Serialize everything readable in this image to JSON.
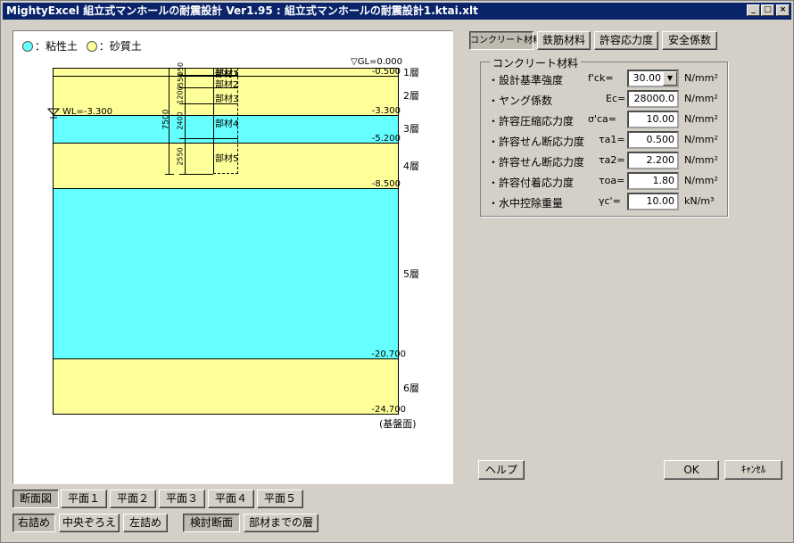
{
  "window": {
    "title": "MightyExcel 組立式マンホールの耐震設計 Ver1.95 : 組立式マンホールの耐震設計1.ktai.xlt"
  },
  "titlebar_buttons": {
    "minimize": "_",
    "maximize": "□",
    "close": "×"
  },
  "legend": {
    "clay": "：粘性土",
    "sand": "：砂質土",
    "clay_color": "#66ffff",
    "sand_color": "#ffff99"
  },
  "diagram": {
    "gl": "▽GL=0.000",
    "wl": "WL=-3.300",
    "elevations": [
      "-0.500",
      "-3.300",
      "-5.200",
      "-8.500",
      "-20.700",
      "-24.700"
    ],
    "layers": [
      "1層",
      "2層",
      "3層",
      "4層",
      "5層",
      "6層"
    ],
    "base": "(基盤面)",
    "members": [
      "部材1",
      "部材2",
      "部材3",
      "部材4",
      "部材5"
    ],
    "dims": {
      "total": "7500",
      "d1": "550",
      "d2": "1200",
      "d3": "2400",
      "d4": "2550",
      "d5": "050"
    }
  },
  "tabs": [
    "コンクリート材料",
    "鉄筋材料",
    "許容応力度",
    "安全係数"
  ],
  "group": {
    "title": "コンクリート材料",
    "rows": [
      {
        "label": "・設計基準強度",
        "sym": "f'ck=",
        "value": "30.00",
        "unit": "N/mm²"
      },
      {
        "label": "・ヤング係数",
        "sym": "Ec=",
        "value": "28000.0",
        "unit": "N/mm²"
      },
      {
        "label": "・許容圧縮応力度",
        "sym": "σ'ca=",
        "value": "10.00",
        "unit": "N/mm²"
      },
      {
        "label": "・許容せん断応力度",
        "sym": "τa1=",
        "value": "0.500",
        "unit": "N/mm²"
      },
      {
        "label": "・許容せん断応力度",
        "sym": "τa2=",
        "value": "2.200",
        "unit": "N/mm²"
      },
      {
        "label": "・許容付着応力度",
        "sym": "τoa=",
        "value": "1.80",
        "unit": "N/mm²"
      },
      {
        "label": "・水中控除重量",
        "sym": "γc'=",
        "value": "10.00",
        "unit": "kN/m³"
      }
    ]
  },
  "buttons": {
    "help": "ヘルプ",
    "ok": "OK",
    "cancel": "ｷｬﾝｾﾙ",
    "view": [
      "断面図",
      "平面１",
      "平面２",
      "平面３",
      "平面４",
      "平面５"
    ],
    "align": [
      "右詰め",
      "中央ぞろえ",
      "左詰め"
    ],
    "section": [
      "検討断面",
      "部材までの層"
    ]
  }
}
